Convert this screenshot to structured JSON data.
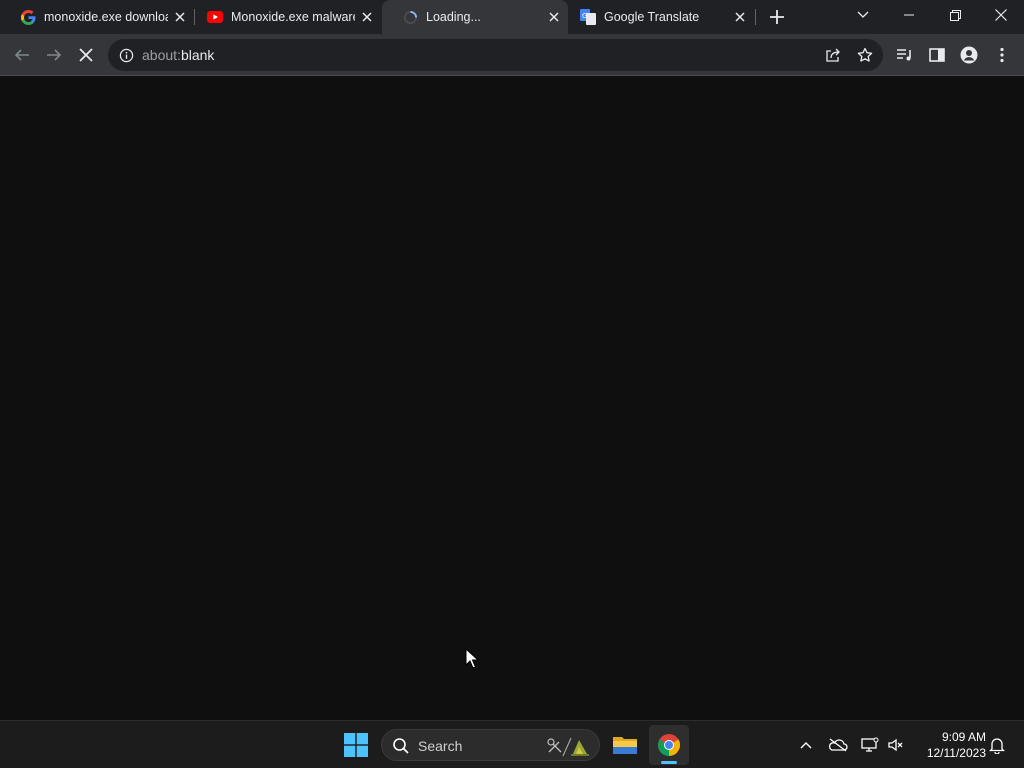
{
  "browser": {
    "tabs": [
      {
        "title": "monoxide.exe downloa",
        "favicon": "google-icon",
        "active": false
      },
      {
        "title": "Monoxide.exe malware",
        "favicon": "youtube-icon",
        "active": false
      },
      {
        "title": "Loading...",
        "favicon": "loading-spinner-icon",
        "active": true
      },
      {
        "title": "Google Translate",
        "favicon": "google-translate-icon",
        "active": false
      }
    ],
    "omnibox": {
      "scheme": "about:",
      "host": "blank"
    }
  },
  "taskbar": {
    "search_label": "Search",
    "clock_time": "9:09 AM",
    "clock_date": "12/11/2023",
    "accent": "#4cc2ff"
  }
}
